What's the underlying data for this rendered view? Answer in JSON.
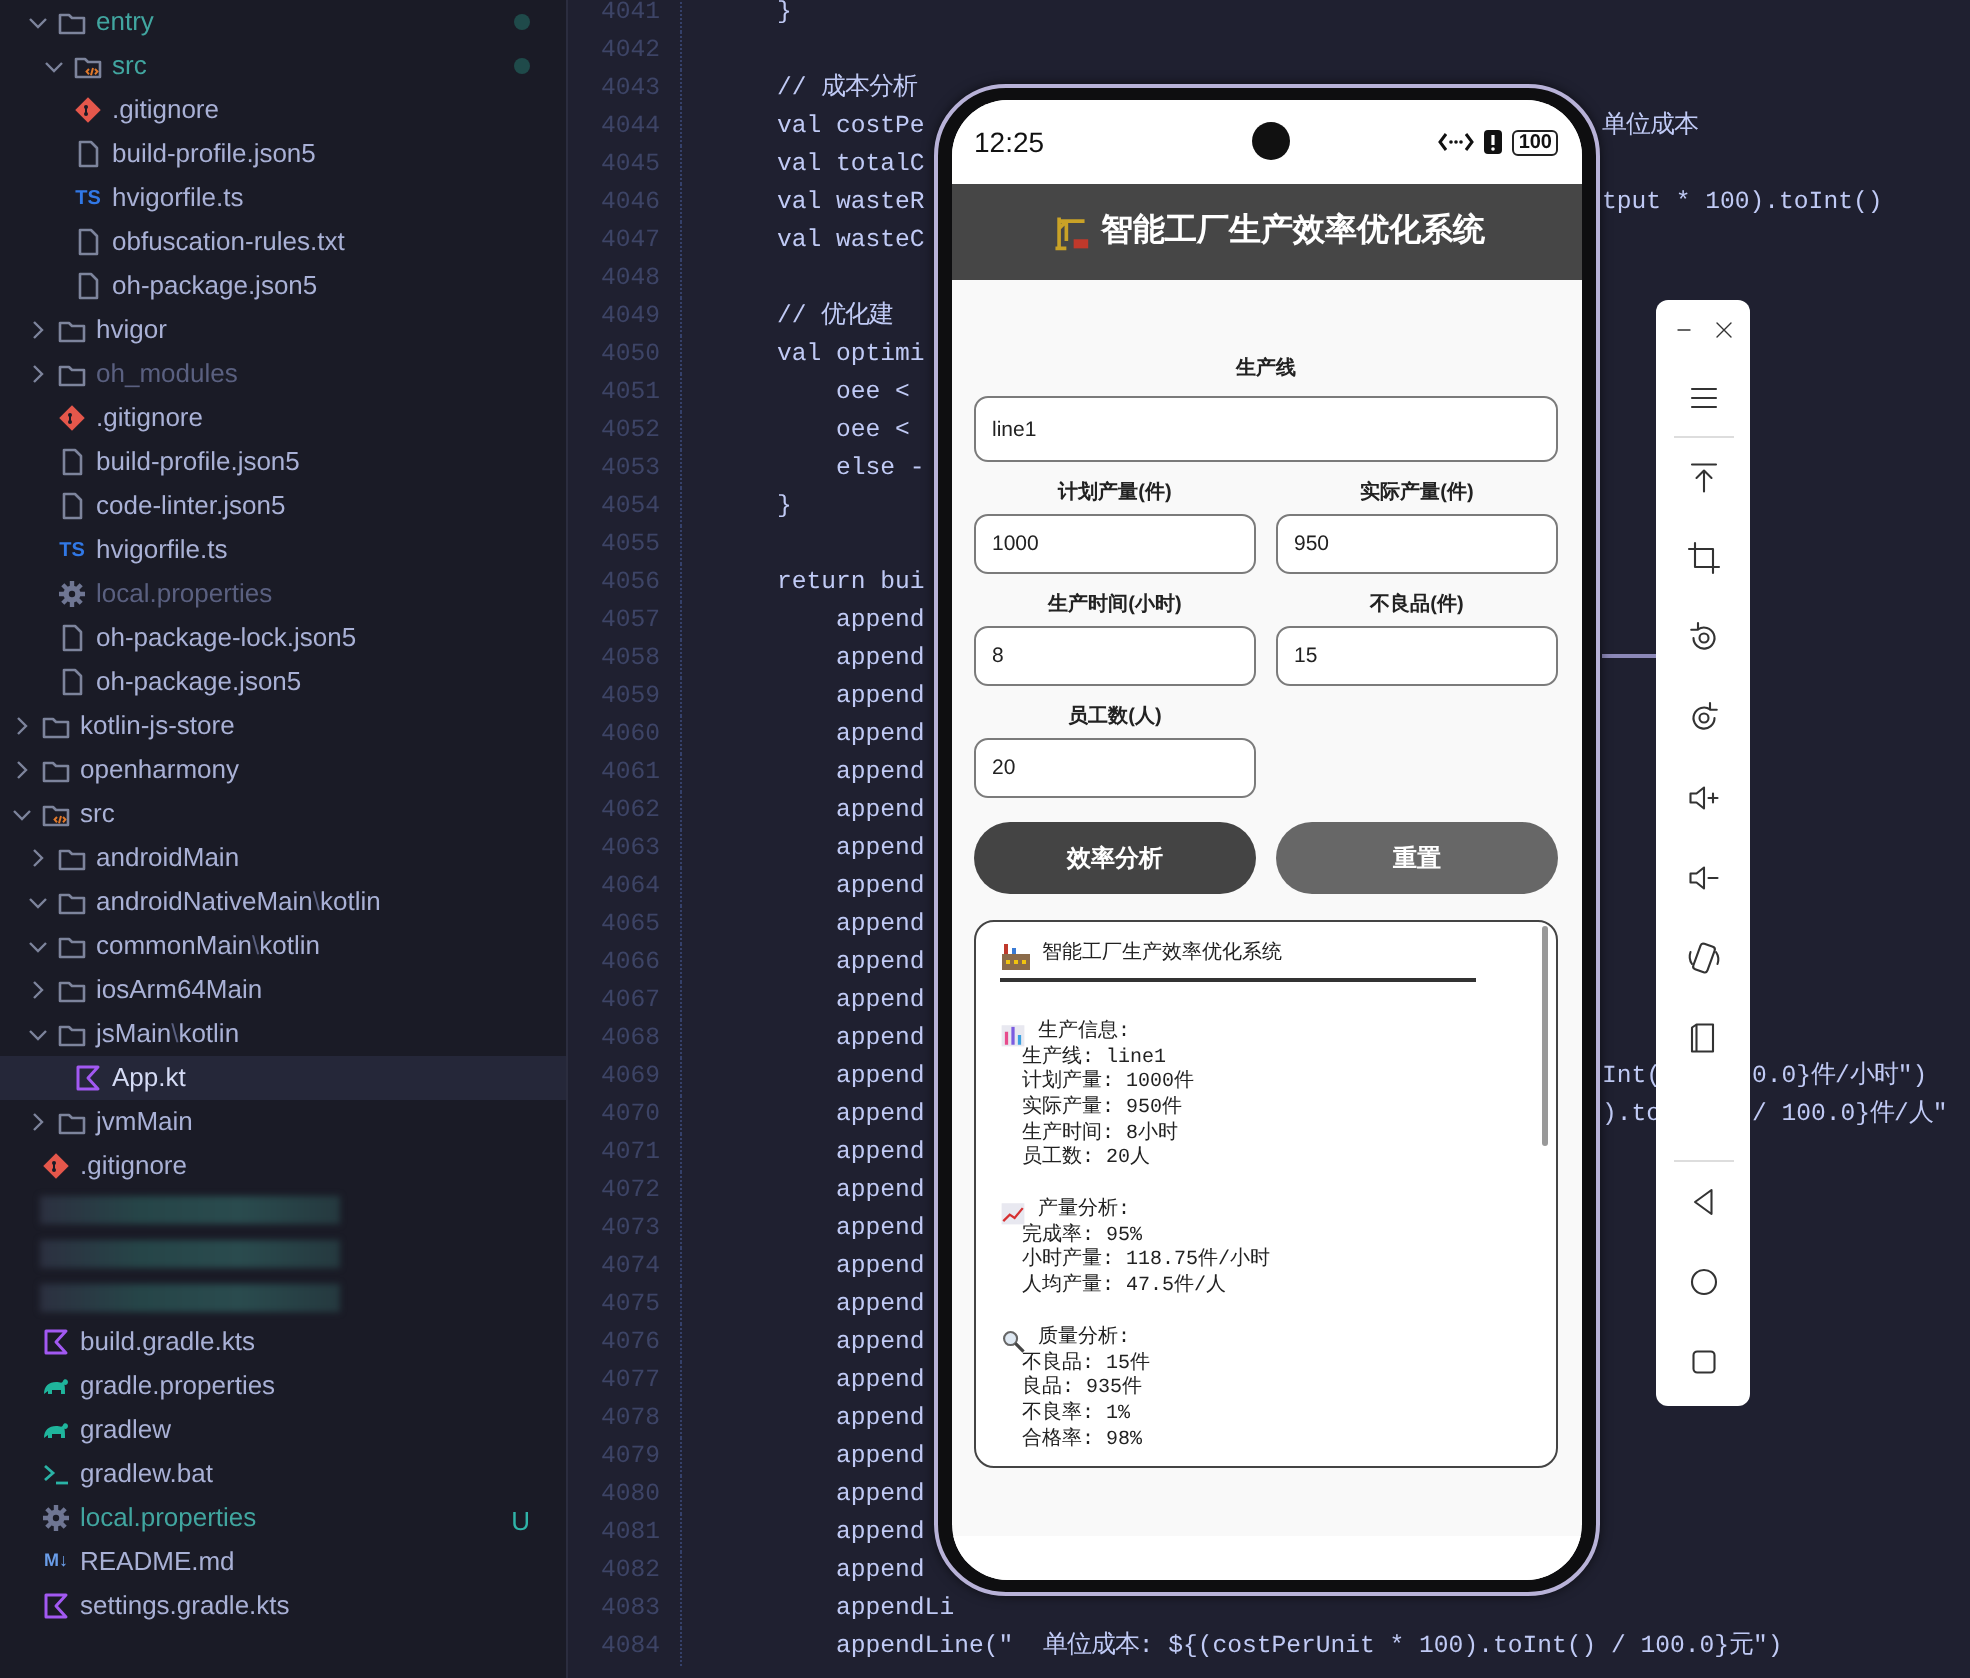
{
  "file_tree": {
    "continued_items": [
      {
        "label_parts": [
          "entry"
        ],
        "kind": "folder",
        "expanded": true,
        "changed": true,
        "selected": false,
        "children": [
          {
            "label_parts": [
              "src"
            ],
            "kind": "source-folder",
            "expanded": true,
            "changed": true,
            "selected": false
          },
          {
            "label_parts": [
              ".gitignore"
            ],
            "kind": "git-file",
            "selected": false
          },
          {
            "label_parts": [
              "build-profile.json5"
            ],
            "kind": "file",
            "selected": false
          },
          {
            "label_parts": [
              "hvigorfile.ts"
            ],
            "kind": "ts-file",
            "icon_label": "TS",
            "selected": false
          },
          {
            "label_parts": [
              "obfuscation-rules.txt"
            ],
            "kind": "file",
            "selected": false
          },
          {
            "label_parts": [
              "oh-package.json5"
            ],
            "kind": "file",
            "selected": false
          }
        ]
      },
      {
        "label_parts": [
          "hvigor"
        ],
        "kind": "folder",
        "expanded": false,
        "selected": false
      },
      {
        "label_parts": [
          "oh_modules"
        ],
        "kind": "folder",
        "expanded": false,
        "ignored": true,
        "selected": false
      },
      {
        "label_parts": [
          ".gitignore"
        ],
        "kind": "git-file",
        "selected": false
      },
      {
        "label_parts": [
          "build-profile.json5"
        ],
        "kind": "file",
        "selected": false
      },
      {
        "label_parts": [
          "code-linter.json5"
        ],
        "kind": "file",
        "selected": false
      },
      {
        "label_parts": [
          "hvigorfile.ts"
        ],
        "kind": "ts-file",
        "icon_label": "TS",
        "selected": false
      },
      {
        "label_parts": [
          "local.properties"
        ],
        "kind": "settings-file",
        "ignored": true,
        "selected": false
      },
      {
        "label_parts": [
          "oh-package-lock.json5"
        ],
        "kind": "file",
        "selected": false
      },
      {
        "label_parts": [
          "oh-package.json5"
        ],
        "kind": "file",
        "selected": false
      }
    ],
    "items": [
      {
        "label_parts": [
          "kotlin-js-store"
        ],
        "kind": "folder",
        "expanded": false,
        "selected": false
      },
      {
        "label_parts": [
          "openharmony"
        ],
        "kind": "folder",
        "expanded": false,
        "selected": false
      },
      {
        "label_parts": [
          "src"
        ],
        "kind": "source-folder",
        "expanded": true,
        "selected": false,
        "children": [
          {
            "label_parts": [
              "androidMain"
            ],
            "kind": "folder",
            "expanded": false,
            "selected": false
          },
          {
            "label_parts": [
              "androidNativeMain",
              "\\",
              "kotlin"
            ],
            "kind": "folder",
            "expanded": true,
            "selected": false
          },
          {
            "label_parts": [
              "commonMain",
              "\\",
              "kotlin"
            ],
            "kind": "folder",
            "expanded": true,
            "selected": false
          },
          {
            "label_parts": [
              "iosArm64Main"
            ],
            "kind": "folder",
            "expanded": false,
            "selected": false
          },
          {
            "label_parts": [
              "jsMain",
              "\\",
              "kotlin"
            ],
            "kind": "folder",
            "expanded": true,
            "selected": false,
            "children": [
              {
                "label_parts": [
                  "App.kt"
                ],
                "kind": "kotlin-file",
                "selected": true
              }
            ]
          },
          {
            "label_parts": [
              "jvmMain"
            ],
            "kind": "folder",
            "expanded": false,
            "selected": false
          }
        ]
      },
      {
        "label_parts": [
          ".gitignore"
        ],
        "kind": "git-file",
        "selected": false
      },
      {
        "kind": "blurred"
      },
      {
        "kind": "blurred"
      },
      {
        "kind": "blurred"
      },
      {
        "label_parts": [
          "build.gradle.kts"
        ],
        "kind": "kotlin-file",
        "selected": false
      },
      {
        "label_parts": [
          "gradle.properties"
        ],
        "kind": "gradle-file",
        "selected": false
      },
      {
        "label_parts": [
          "gradlew"
        ],
        "kind": "gradle-file",
        "selected": false
      },
      {
        "label_parts": [
          "gradlew.bat"
        ],
        "kind": "script-file",
        "selected": false
      },
      {
        "label_parts": [
          "local.properties"
        ],
        "kind": "settings-file",
        "changed": true,
        "badge": "U",
        "selected": false
      },
      {
        "label_parts": [
          "README.md"
        ],
        "kind": "markdown-file",
        "icon_label": "M↓",
        "selected": false
      },
      {
        "label_parts": [
          "settings.gradle.kts"
        ],
        "kind": "kotlin-file",
        "selected": false
      }
    ]
  },
  "editor": {
    "lines": [
      {
        "number": "4041",
        "code": "    }"
      },
      {
        "number": "4042"
      },
      {
        "number": "4043",
        "code": "    // 成本分析"
      },
      {
        "number": "4044",
        "code": "    val costPe",
        "right": "单位成本"
      },
      {
        "number": "4045",
        "code": "    val totalC"
      },
      {
        "number": "4046",
        "code": "    val wasteR",
        "right": "tput * 100).toInt()"
      },
      {
        "number": "4047",
        "code": "    val wasteC"
      },
      {
        "number": "4048"
      },
      {
        "number": "4049",
        "code": "    // 优化建"
      },
      {
        "number": "4050",
        "code": "    val optimi"
      },
      {
        "number": "4051",
        "code": "        oee <"
      },
      {
        "number": "4052",
        "code": "        oee <"
      },
      {
        "number": "4053",
        "code": "        else -"
      },
      {
        "number": "4054",
        "code": "    }"
      },
      {
        "number": "4055"
      },
      {
        "number": "4056",
        "code": "    return bui"
      },
      {
        "number": "4057",
        "code": "        append"
      },
      {
        "number": "4058",
        "code": "        append"
      },
      {
        "number": "4059",
        "code": "        append"
      },
      {
        "number": "4060",
        "code": "        append"
      },
      {
        "number": "4061",
        "code": "        append"
      },
      {
        "number": "4062",
        "code": "        append"
      },
      {
        "number": "4063",
        "code": "        append"
      },
      {
        "number": "4064",
        "code": "        append"
      },
      {
        "number": "4065",
        "code": "        append"
      },
      {
        "number": "4066",
        "code": "        append"
      },
      {
        "number": "4067",
        "code": "        append"
      },
      {
        "number": "4068",
        "code": "        append"
      },
      {
        "number": "4069",
        "code": "        append",
        "right": "Int(",
        "right_2": "0.0}件/小时\")"
      },
      {
        "number": "4070",
        "code": "        append",
        "right": ").to",
        "right_2": "/ 100.0}件/人\""
      },
      {
        "number": "4071",
        "code": "        append"
      },
      {
        "number": "4072",
        "code": "        append"
      },
      {
        "number": "4073",
        "code": "        append"
      },
      {
        "number": "4074",
        "code": "        append"
      },
      {
        "number": "4075",
        "code": "        append"
      },
      {
        "number": "4076",
        "code": "        append"
      },
      {
        "number": "4077",
        "code": "        append"
      },
      {
        "number": "4078",
        "code": "        append"
      },
      {
        "number": "4079",
        "code": "        append"
      },
      {
        "number": "4080",
        "code": "        append"
      },
      {
        "number": "4081",
        "code": "        append"
      },
      {
        "number": "4082",
        "code": "        append"
      },
      {
        "number": "4083",
        "code": "        appendLi"
      },
      {
        "number": "4084",
        "code": "        appendLine(\"  单位成本: ${(costPerUnit * 100).toInt() / 100.0}元\")"
      }
    ]
  },
  "phone": {
    "status_bar": {
      "time": "12:25",
      "battery": "100"
    },
    "app": {
      "title": "智能工厂生产效率优化系统",
      "field_rows": [
        {
          "wide": true,
          "fields": [
            {
              "label": "生产线",
              "value": "line1"
            }
          ]
        },
        {
          "wide": false,
          "fields": [
            {
              "label": "计划产量(件)",
              "value": "1000"
            },
            {
              "label": "实际产量(件)",
              "value": "950"
            }
          ]
        },
        {
          "wide": false,
          "fields": [
            {
              "label": "生产时间(小时)",
              "value": "8"
            },
            {
              "label": "不良品(件)",
              "value": "15"
            }
          ]
        },
        {
          "wide": false,
          "fields": [
            {
              "label": "员工数(人)",
              "value": "20"
            }
          ]
        }
      ],
      "buttons": [
        {
          "label": "效率分析",
          "kind": "primary"
        },
        {
          "label": "重置",
          "kind": "secondary"
        }
      ],
      "report": {
        "title": "智能工厂生产效率优化系统",
        "sections": [
          {
            "kind": "production",
            "heading": "生产信息:",
            "lines": [
              "生产线: line1",
              "计划产量: 1000件",
              "实际产量: 950件",
              "生产时间: 8小时",
              "员工数: 20人"
            ]
          },
          {
            "kind": "output",
            "heading": "产量分析:",
            "lines": [
              "完成率: 95%",
              "小时产量: 118.75件/小时",
              "人均产量: 47.5件/人"
            ]
          },
          {
            "kind": "quality",
            "heading": "质量分析:",
            "lines": [
              "不良品: 15件",
              "良品: 935件",
              "不良率: 1%",
              "合格率: 98%"
            ]
          }
        ]
      }
    }
  }
}
